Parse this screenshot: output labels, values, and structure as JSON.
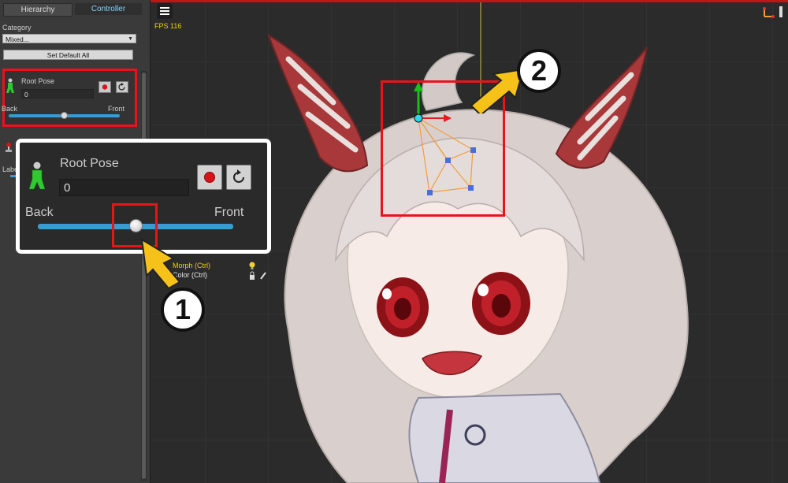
{
  "tabs": {
    "hierarchy": "Hierarchy",
    "controller": "Controller"
  },
  "category": {
    "label": "Category",
    "value": "Mixed..."
  },
  "set_default_all": "Set Default All",
  "partial_label": "Labe",
  "root_pose": {
    "title": "Root Pose",
    "value": "0",
    "back_label": "Back",
    "front_label": "Front",
    "slider_fraction": 0.5
  },
  "viewport": {
    "fps": "FPS 116",
    "morph_ctrl": "Morph (Ctrl)",
    "color_ctrl": "Color (Ctrl)"
  },
  "steps": {
    "one": "1",
    "two": "2"
  },
  "colors": {
    "highlight_red": "#e8141a",
    "arrow_yellow": "#f6c21a",
    "slider_blue": "#3a9ad1",
    "mesh_orange": "#f39c3c",
    "vertex_blue": "#4a6fd8",
    "fps_yellow": "#f1d400"
  }
}
